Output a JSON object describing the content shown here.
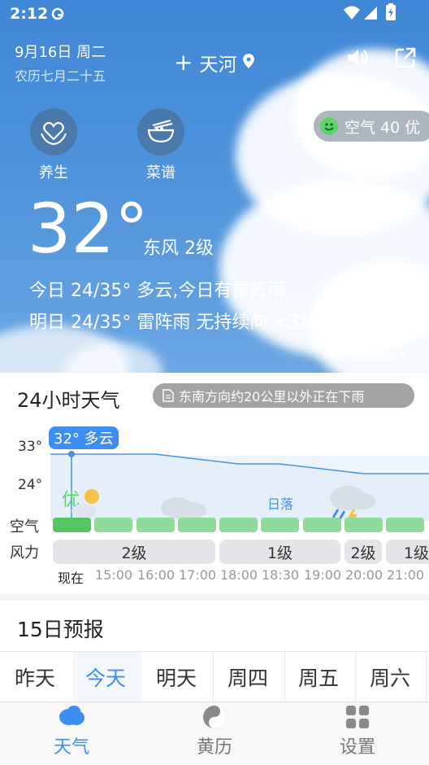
{
  "status_bar": {
    "time": "2:12"
  },
  "header": {
    "date": "9月16日 周二",
    "lunar": "农历七月二十五",
    "city": "天河",
    "add_symbol": "+"
  },
  "shortcuts": [
    {
      "label": "养生",
      "icon": "heart-hands-icon"
    },
    {
      "label": "菜谱",
      "icon": "bowl-icon"
    }
  ],
  "air_badge": {
    "text": "空气 40 优",
    "color": "#5bd36b"
  },
  "current": {
    "temp": "32°",
    "wind": "东风 2级",
    "today": "今日 24/35° 多云,今日有雷阵雨",
    "tomorrow": "明日 24/35° 雷阵雨 无持续向 <3级",
    "published": "7分钟前发布"
  },
  "hourly": {
    "title": "24小时天气",
    "alert": "东南方向约20公里以外正在下雨",
    "tooltip": "32° 多云",
    "high_label": "33°",
    "low_label": "24°",
    "aq_label": "空气",
    "wind_label": "风力",
    "aq_quality_text": "优",
    "sunset_text": "日落",
    "times": [
      "现在",
      "15:00",
      "16:00",
      "17:00",
      "18:00",
      "18:30",
      "19:00",
      "20:00",
      "21:00"
    ],
    "wind_segments": [
      "2级",
      "1级",
      "2级",
      "1级"
    ],
    "temps": [
      32,
      32,
      32,
      31,
      30,
      30,
      29,
      28,
      28
    ]
  },
  "forecast": {
    "title": "15日预报",
    "tabs": [
      "昨天",
      "今天",
      "明天",
      "周四",
      "周五",
      "周六"
    ],
    "active_tab": "今天"
  },
  "bottom_nav": [
    {
      "label": "天气",
      "icon": "cloud-icon",
      "active": true
    },
    {
      "label": "黄历",
      "icon": "yin-yang-icon",
      "active": false
    },
    {
      "label": "设置",
      "icon": "grid-icon",
      "active": false
    }
  ],
  "colors": {
    "accent": "#3d8ef0",
    "air_good": "#5bd36b",
    "line": "#4a90e2"
  }
}
